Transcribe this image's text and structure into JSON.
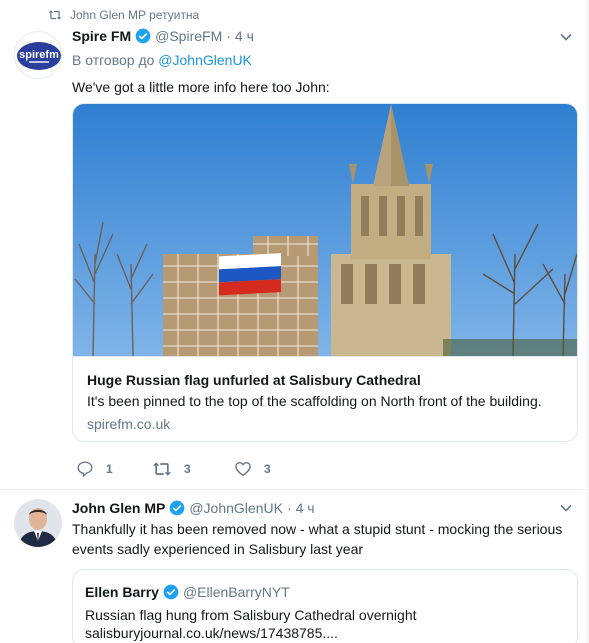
{
  "retweet_context": {
    "text": "John Glen MP ретуитна"
  },
  "tweet1": {
    "author_name": "Spire FM",
    "author_handle": "@SpireFM",
    "time": "4 ч",
    "reply_prefix": "В отговор до",
    "reply_handle": "@JohnGlenUK",
    "text": "We've got a little more info here too John:",
    "card": {
      "title": "Huge Russian flag unfurled at Salisbury Cathedral",
      "description": "It's been pinned to the top of the scaffolding on North front of the building.",
      "domain": "spirefm.co.uk"
    },
    "actions": {
      "replies": "1",
      "retweets": "3",
      "likes": "3"
    },
    "avatar_logo_text": "spirefm"
  },
  "tweet2": {
    "author_name": "John Glen MP",
    "author_handle": "@JohnGlenUK",
    "time": "4 ч",
    "text": "Thankfully it has been removed now - what a stupid stunt - mocking the serious events sadly experienced in Salisbury last year",
    "quote": {
      "author_name": "Ellen Barry",
      "author_handle": "@EllenBarryNYT",
      "text": "Russian flag hung from Salisbury Cathedral overnight",
      "link": "salisburyjournal.co.uk/news/17438785...."
    }
  },
  "colors": {
    "accent": "#1b95e0",
    "muted": "#657786",
    "text": "#14171a",
    "border": "#e1e8ed",
    "verified": "#1da1f2"
  },
  "icons": [
    "retweet-icon",
    "verified-badge-icon",
    "chevron-down-icon",
    "reply-icon",
    "retweet-action-icon",
    "like-icon"
  ]
}
